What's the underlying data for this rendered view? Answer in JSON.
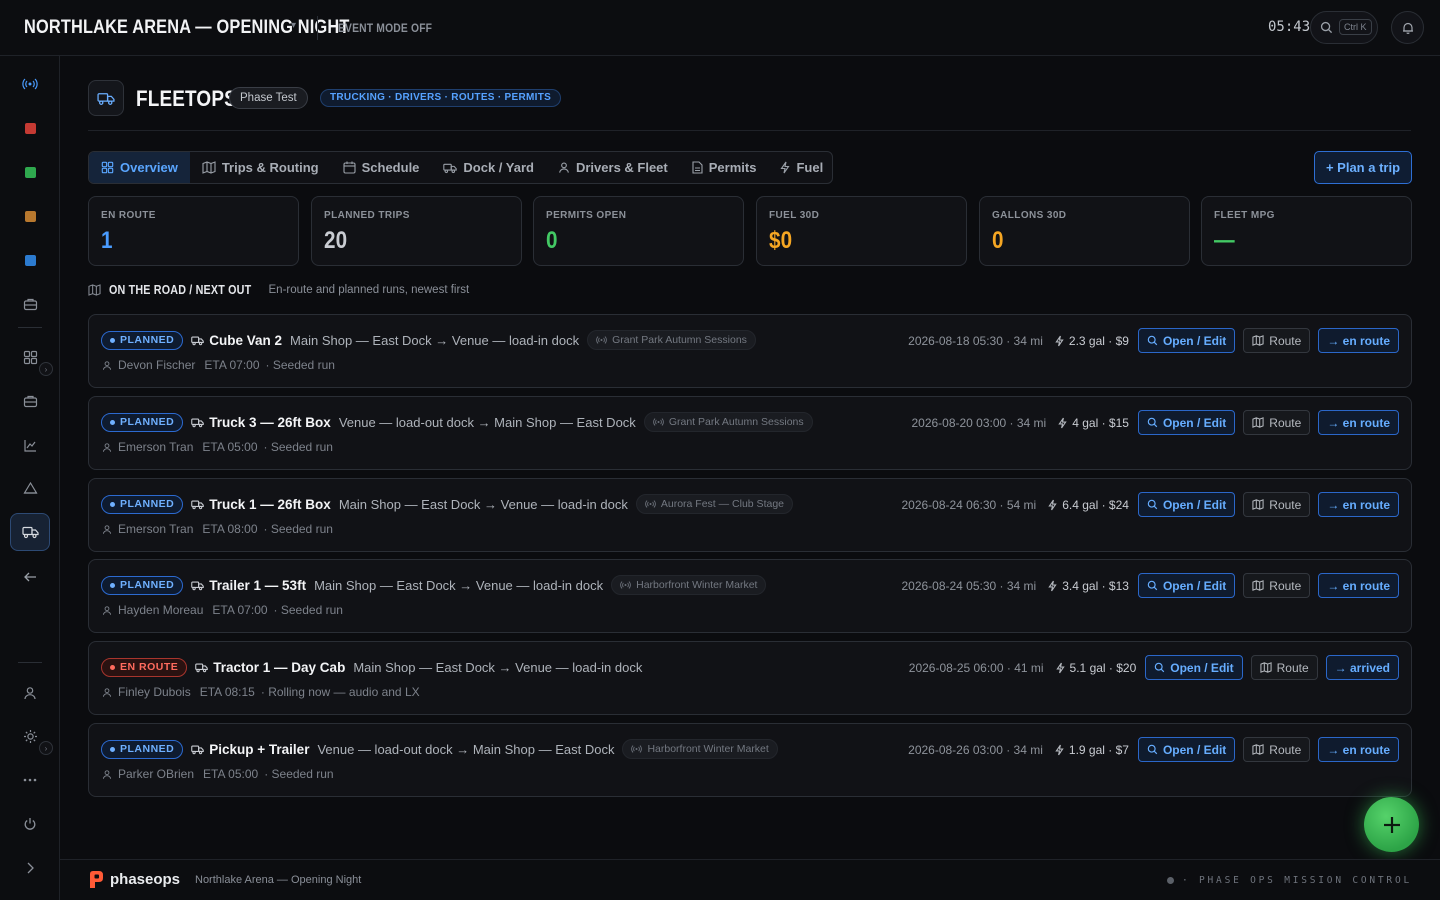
{
  "topbar": {
    "title": "NORTHLAKE ARENA — OPENING NIGHT",
    "title_caret": "▾",
    "event_mode": "EVENT MODE OFF",
    "clock": "05:43",
    "search_shortcut": "Ctrl K"
  },
  "header": {
    "title": "FLEETOPS",
    "phase_badge": "Phase Test",
    "category_badge": "TRUCKING · DRIVERS · ROUTES · PERMITS"
  },
  "tabs": [
    {
      "label": "Overview",
      "icon": "grid-icon"
    },
    {
      "label": "Trips & Routing",
      "icon": "map-icon"
    },
    {
      "label": "Schedule",
      "icon": "calendar-icon"
    },
    {
      "label": "Dock / Yard",
      "icon": "truck-icon"
    },
    {
      "label": "Drivers & Fleet",
      "icon": "person-icon"
    },
    {
      "label": "Permits",
      "icon": "document-icon"
    },
    {
      "label": "Fuel",
      "icon": "bolt-icon"
    }
  ],
  "plan_button": "+ Plan a trip",
  "stats": [
    {
      "label": "EN ROUTE",
      "value": "1",
      "color": "#4a9cff"
    },
    {
      "label": "PLANNED TRIPS",
      "value": "20",
      "color": "#c9ccd2"
    },
    {
      "label": "PERMITS OPEN",
      "value": "0",
      "color": "#43c964"
    },
    {
      "label": "FUEL 30D",
      "value": "$0",
      "color": "#f5a623"
    },
    {
      "label": "GALLONS 30D",
      "value": "0",
      "color": "#f5a623"
    },
    {
      "label": "FLEET MPG",
      "value": "—",
      "color": "#43c964"
    }
  ],
  "section": {
    "title": "ON THE ROAD / NEXT OUT",
    "subtitle": "En-route and planned runs, newest first"
  },
  "trips": [
    {
      "status": "PLANNED",
      "status_kind": "planned",
      "vehicle": "Cube Van 2",
      "route": "Main Shop — East Dock → Venue — load-in dock",
      "event": "Grant Park Autumn Sessions",
      "driver": "Devon Fischer",
      "eta": "ETA 07:00",
      "note": "· Seeded run",
      "meta": "2026-08-18 05:30 · 34 mi",
      "fuel": "2.3 gal · $9",
      "open": "Open / Edit",
      "route_btn": "Route",
      "advance": "→ en route"
    },
    {
      "status": "PLANNED",
      "status_kind": "planned",
      "vehicle": "Truck 3 — 26ft Box",
      "route": "Venue — load-out dock → Main Shop — East Dock",
      "event": "Grant Park Autumn Sessions",
      "driver": "Emerson Tran",
      "eta": "ETA 05:00",
      "note": "· Seeded run",
      "meta": "2026-08-20 03:00 · 34 mi",
      "fuel": "4 gal · $15",
      "open": "Open / Edit",
      "route_btn": "Route",
      "advance": "→ en route"
    },
    {
      "status": "PLANNED",
      "status_kind": "planned",
      "vehicle": "Truck 1 — 26ft Box",
      "route": "Main Shop — East Dock → Venue — load-in dock",
      "event": "Aurora Fest — Club Stage",
      "driver": "Emerson Tran",
      "eta": "ETA 08:00",
      "note": "· Seeded run",
      "meta": "2026-08-24 06:30 · 54 mi",
      "fuel": "6.4 gal · $24",
      "open": "Open / Edit",
      "route_btn": "Route",
      "advance": "→ en route"
    },
    {
      "status": "PLANNED",
      "status_kind": "planned",
      "vehicle": "Trailer 1 — 53ft",
      "route": "Main Shop — East Dock → Venue — load-in dock",
      "event": "Harborfront Winter Market",
      "driver": "Hayden Moreau",
      "eta": "ETA 07:00",
      "note": "· Seeded run",
      "meta": "2026-08-24 05:30 · 34 mi",
      "fuel": "3.4 gal · $13",
      "open": "Open / Edit",
      "route_btn": "Route",
      "advance": "→ en route"
    },
    {
      "status": "EN ROUTE",
      "status_kind": "enroute",
      "vehicle": "Tractor 1 — Day Cab",
      "route": "Main Shop — East Dock → Venue — load-in dock",
      "event": "",
      "driver": "Finley Dubois",
      "eta": "ETA 08:15",
      "note": "· Rolling now — audio and LX",
      "meta": "2026-08-25 06:00 · 41 mi",
      "fuel": "5.1 gal · $20",
      "open": "Open / Edit",
      "route_btn": "Route",
      "advance": "→ arrived"
    },
    {
      "status": "PLANNED",
      "status_kind": "planned",
      "vehicle": "Pickup + Trailer",
      "route": "Venue — load-out dock → Main Shop — East Dock",
      "event": "Harborfront Winter Market",
      "driver": "Parker OBrien",
      "eta": "ETA 05:00",
      "note": "· Seeded run",
      "meta": "2026-08-26 03:00 · 34 mi",
      "fuel": "1.9 gal · $7",
      "open": "Open / Edit",
      "route_btn": "Route",
      "advance": "→ en route"
    }
  ],
  "footer": {
    "brand": "phaseops",
    "event": "Northlake Arena — Opening Night",
    "tagline": "· PHASE OPS MISSION CONTROL"
  },
  "colors": {
    "accent": "#4a9cff",
    "enroute": "#ff6b5e",
    "fab": "#3dbb55",
    "brand": "#ff5a36"
  }
}
